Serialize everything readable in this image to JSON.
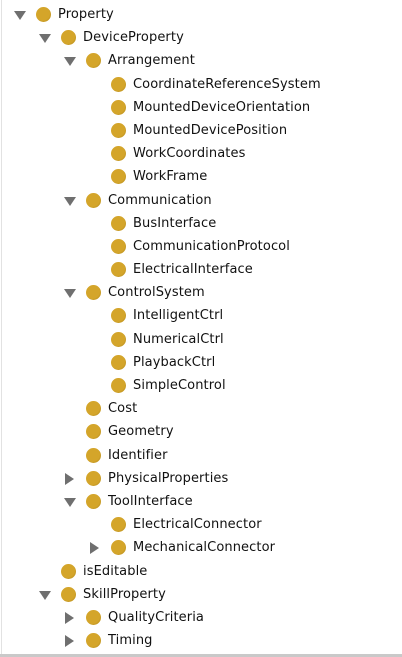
{
  "tree": {
    "icon_color": "#d4a52a",
    "nodes": [
      {
        "label": "Property",
        "depth": 0,
        "toggle": "expanded"
      },
      {
        "label": "DeviceProperty",
        "depth": 1,
        "toggle": "expanded"
      },
      {
        "label": "Arrangement",
        "depth": 2,
        "toggle": "expanded"
      },
      {
        "label": "CoordinateReferenceSystem",
        "depth": 3,
        "toggle": "none"
      },
      {
        "label": "MountedDeviceOrientation",
        "depth": 3,
        "toggle": "none"
      },
      {
        "label": "MountedDevicePosition",
        "depth": 3,
        "toggle": "none"
      },
      {
        "label": "WorkCoordinates",
        "depth": 3,
        "toggle": "none"
      },
      {
        "label": "WorkFrame",
        "depth": 3,
        "toggle": "none"
      },
      {
        "label": "Communication",
        "depth": 2,
        "toggle": "expanded"
      },
      {
        "label": "BusInterface",
        "depth": 3,
        "toggle": "none"
      },
      {
        "label": "CommunicationProtocol",
        "depth": 3,
        "toggle": "none"
      },
      {
        "label": "ElectricalInterface",
        "depth": 3,
        "toggle": "none"
      },
      {
        "label": "ControlSystem",
        "depth": 2,
        "toggle": "expanded"
      },
      {
        "label": "IntelligentCtrl",
        "depth": 3,
        "toggle": "none"
      },
      {
        "label": "NumericalCtrl",
        "depth": 3,
        "toggle": "none"
      },
      {
        "label": "PlaybackCtrl",
        "depth": 3,
        "toggle": "none"
      },
      {
        "label": "SimpleControl",
        "depth": 3,
        "toggle": "none"
      },
      {
        "label": "Cost",
        "depth": 2,
        "toggle": "none"
      },
      {
        "label": "Geometry",
        "depth": 2,
        "toggle": "none"
      },
      {
        "label": "Identifier",
        "depth": 2,
        "toggle": "none"
      },
      {
        "label": "PhysicalProperties",
        "depth": 2,
        "toggle": "collapsed"
      },
      {
        "label": "ToolInterface",
        "depth": 2,
        "toggle": "expanded"
      },
      {
        "label": "ElectricalConnector",
        "depth": 3,
        "toggle": "none"
      },
      {
        "label": "MechanicalConnector",
        "depth": 3,
        "toggle": "collapsed"
      },
      {
        "label": "isEditable",
        "depth": 1,
        "toggle": "none"
      },
      {
        "label": "SkillProperty",
        "depth": 1,
        "toggle": "expanded"
      },
      {
        "label": "QualityCriteria",
        "depth": 2,
        "toggle": "collapsed"
      },
      {
        "label": "Timing",
        "depth": 2,
        "toggle": "collapsed"
      }
    ]
  }
}
